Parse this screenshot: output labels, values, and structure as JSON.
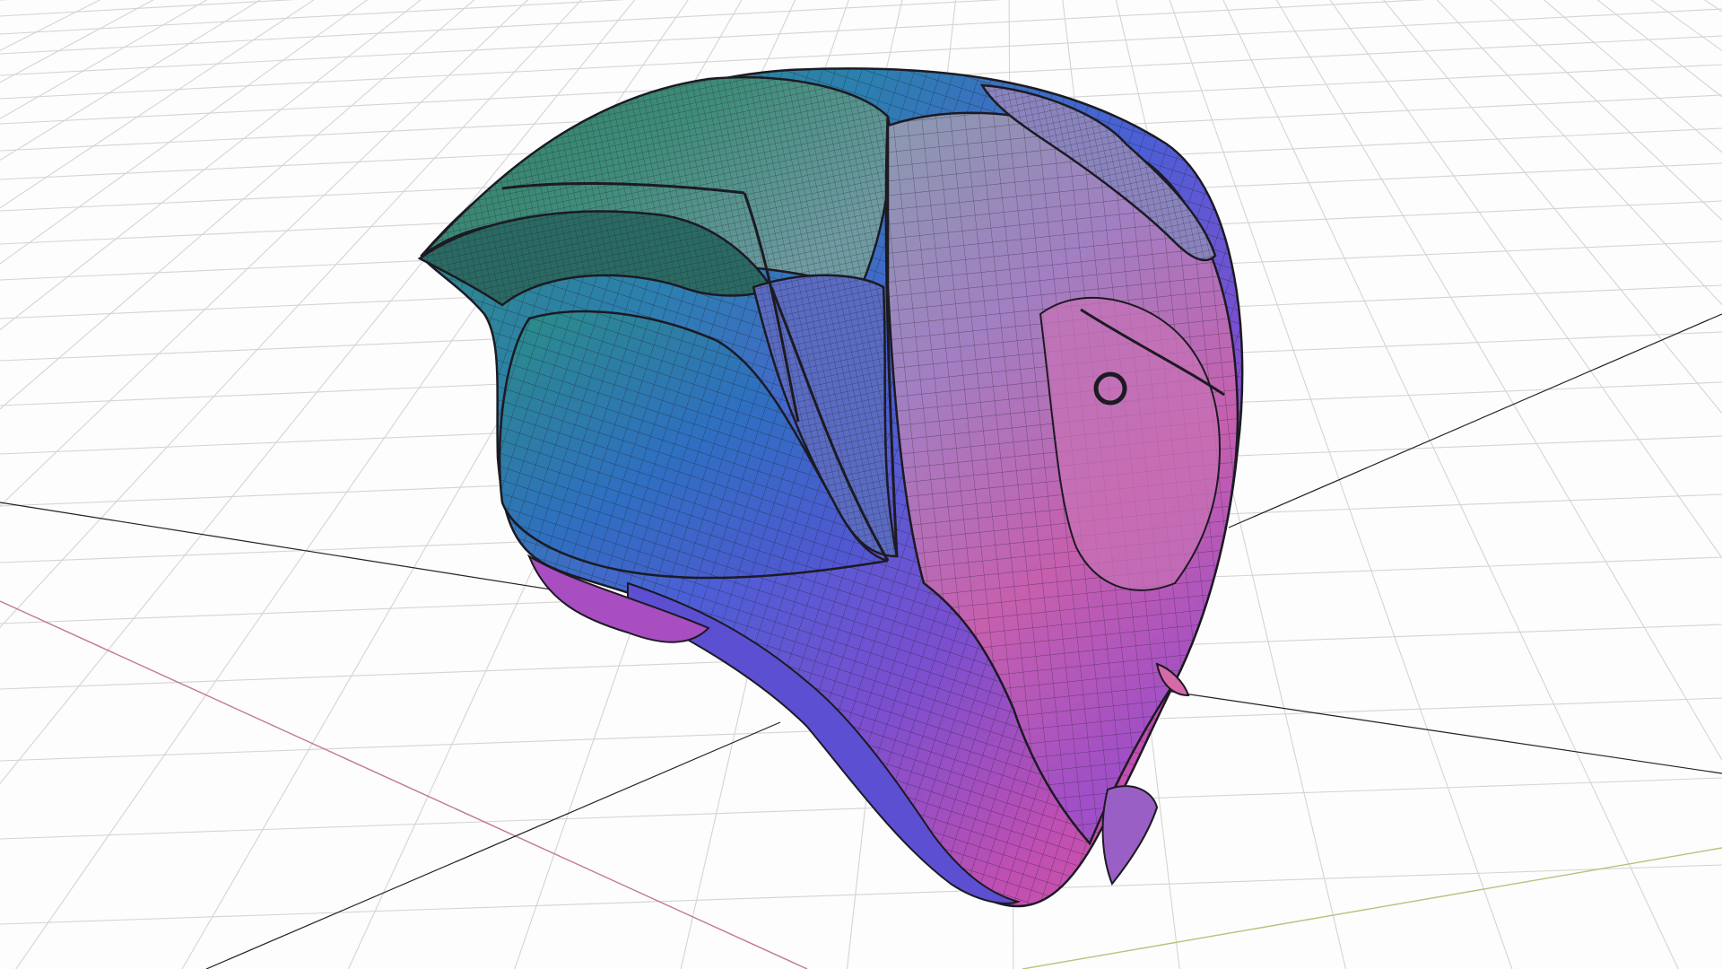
{
  "viewport": {
    "mode": "3d-viewport",
    "background": "#fdfdfd",
    "grid_color": "#d4d4d4",
    "x_axis_color": "#c27a86",
    "y_axis_color": "#b7c27a",
    "mesh_object": "helmet",
    "mesh_palette": [
      "#2f8f6f",
      "#2c7fb0",
      "#4b5fd6",
      "#7a4fd0",
      "#c04fb3",
      "#d45a9c"
    ],
    "wire_color": "#1c1a22",
    "grid_visible": true,
    "wireframe_overlay": true
  }
}
